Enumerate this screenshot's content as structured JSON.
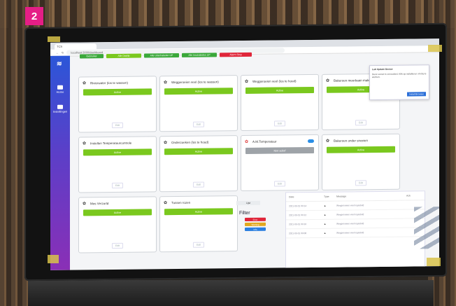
{
  "badge": "2",
  "browser": {
    "tab_label": "TCS",
    "url": "localhost:3000/dashboard"
  },
  "sidebar": {
    "items": [
      {
        "label": "Home"
      },
      {
        "label": "Instellingen"
      }
    ]
  },
  "top_buttons": [
    {
      "label": "Gebruiker",
      "color": "#3aa83a"
    },
    {
      "label": "Alle Dashb",
      "color": "#7ac81e"
    },
    {
      "label": "Alle Uitschakelen UP",
      "color": "#3aa83a"
    },
    {
      "label": "Alle Inschakelen UP",
      "color": "#3aa83a"
    },
    {
      "label": "Alarm Stop",
      "color": "#e0263a"
    }
  ],
  "cards": [
    {
      "title": "Rivierwater (los te wassen)",
      "button": "Active",
      "edit": "Edit"
    },
    {
      "title": "Weggeroeien veel (los te wassen)",
      "button": "Active",
      "edit": "Edit"
    },
    {
      "title": "Weggeroeien veel (los te houd)",
      "button": "Active",
      "edit": "Edit"
    },
    {
      "title": "Bakeroen meerbaan maken",
      "button": "Active",
      "edit": "Edit"
    },
    {
      "title": "Instellen Temperatuurcontrole",
      "button": "Active",
      "edit": "Edit"
    },
    {
      "title": "Onderzoeken (los te houd)",
      "button": "Active",
      "edit": "Edit"
    },
    {
      "title": "A.M.Temperatuur",
      "button": "Niet actief",
      "edit": "Edit",
      "warn": true,
      "toggle": true
    },
    {
      "title": "Bakeroen onder snoeien",
      "button": "Active",
      "edit": "Edit"
    },
    {
      "title": "Mos Verzorld",
      "button": "Active",
      "edit": "Edit"
    },
    {
      "title": "Tussen rozen",
      "button": "Active",
      "edit": "Edit"
    }
  ],
  "filter": {
    "dropdown": "Lijst",
    "label": "Filter",
    "buttons": [
      {
        "label": "Error",
        "color": "#e0263a"
      },
      {
        "label": "Warning",
        "color": "#e2a81f"
      },
      {
        "label": "Info",
        "color": "#2b7fe0"
      }
    ]
  },
  "log": {
    "headers": [
      "Date",
      "Type",
      "Message",
      "Ack"
    ],
    "rows": [
      {
        "date": "2021-03-01 09:14",
        "msg": "Weggeroeien veel ingesteld"
      },
      {
        "date": "2021-03-01 09:12",
        "msg": "Weggeroeien veel ingesteld"
      },
      {
        "date": "2021-03-01 09:10",
        "msg": "Weggeroeien veel ingesteld"
      },
      {
        "date": "2021-03-01 09:08",
        "msg": "Weggeroeien veel ingesteld"
      }
    ]
  },
  "popup": {
    "title": "Lab Update Device",
    "text": "Deze versie is verouderd. Klik op installeren om bij te werken.",
    "button": "Install Browser"
  }
}
